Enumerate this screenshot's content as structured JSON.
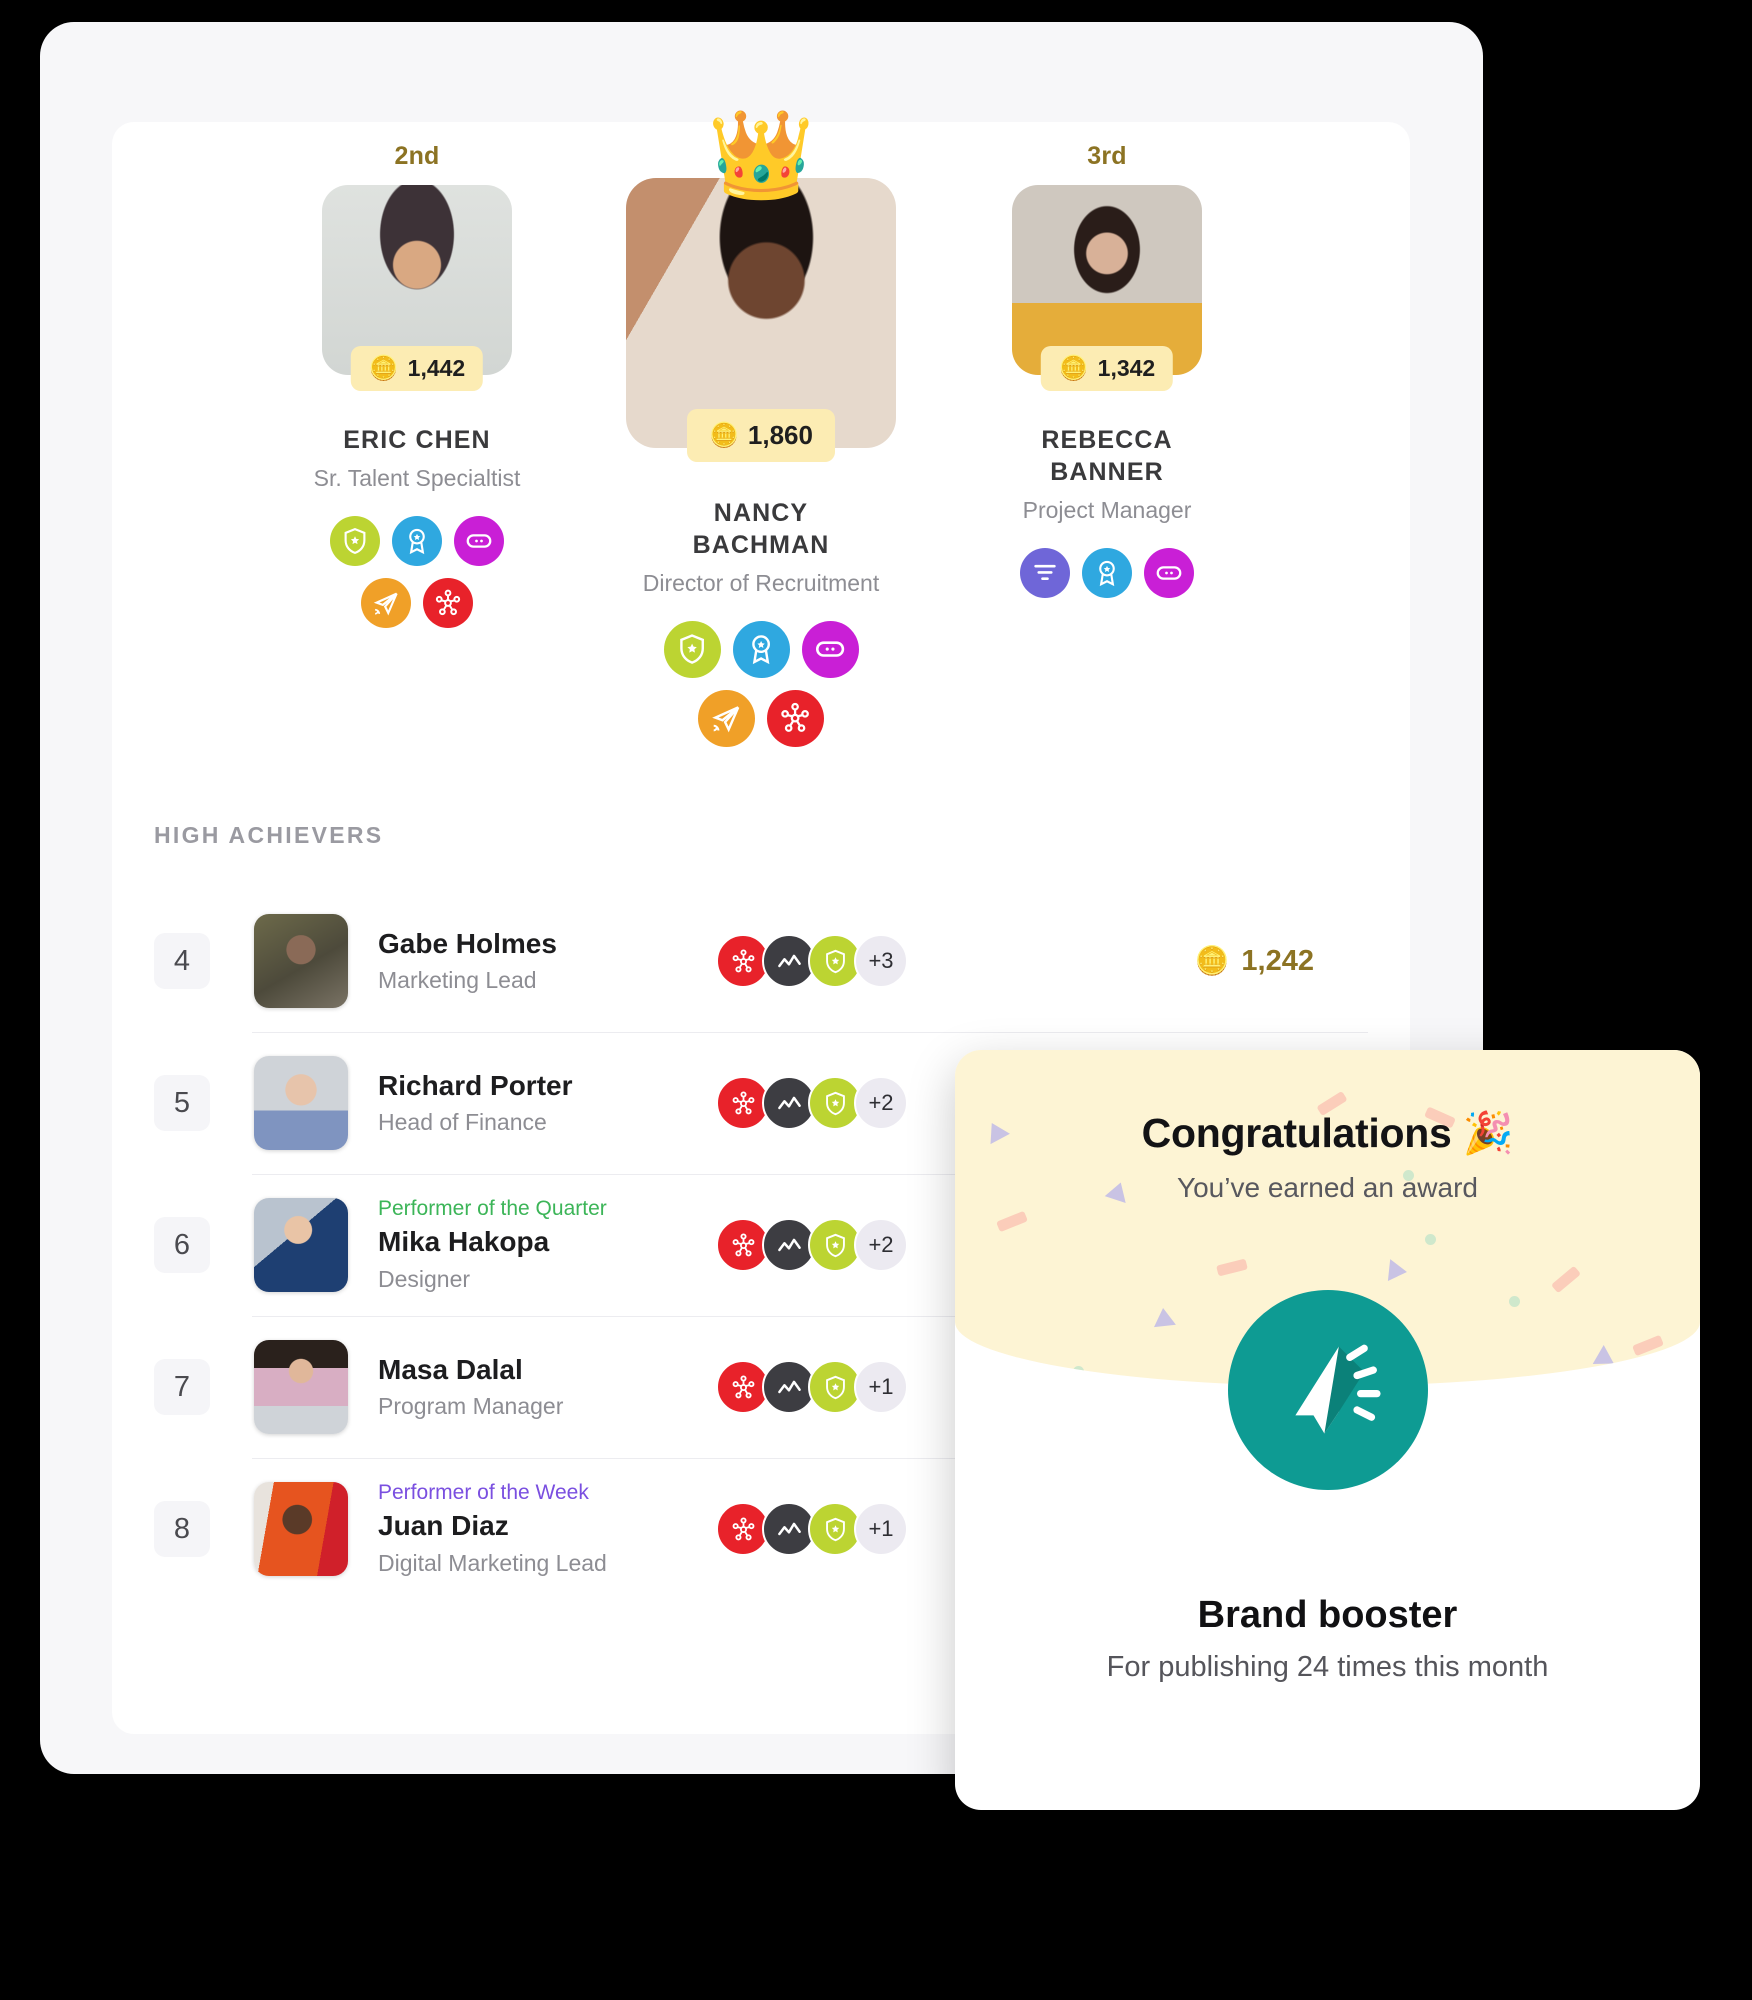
{
  "colors": {
    "background": "#000000",
    "panel": "#f7f7f9",
    "card": "#ffffff",
    "gold": "#8c7323",
    "coin_chip": "#fcecb3",
    "congrats_bg": "#fdf4d4",
    "award_teal": "#0e9b93",
    "quarter_green": "#3cb558",
    "week_purple": "#7a4fe0",
    "badge_red": "#e8222a",
    "badge_dark": "#3d3d42",
    "badge_lime": "#bcd432",
    "badge_blue": "#2fa8e0",
    "badge_magenta": "#c91fd6",
    "badge_orange": "#f0a028",
    "badge_indigo": "#6f66d8",
    "badge_more": "#eceaf1"
  },
  "podium": {
    "second": {
      "rank_label": "2nd",
      "name": "ERIC CHEN",
      "role": "Sr. Talent Specialtist",
      "points": "1,442",
      "coin_icon": "coins-emoji",
      "badges": [
        {
          "icon": "shield-star-icon",
          "color": "#bcd432"
        },
        {
          "icon": "award-ribbon-icon",
          "color": "#2fa8e0"
        },
        {
          "icon": "chat-bubble-icon",
          "color": "#c91fd6"
        },
        {
          "icon": "paper-plane-icon",
          "color": "#f0a028"
        },
        {
          "icon": "network-hub-icon",
          "color": "#e8222a"
        }
      ]
    },
    "first": {
      "rank_label": "",
      "crown_icon": "crown-emoji",
      "name": "NANCY BACHMAN",
      "name_line1": "NANCY",
      "name_line2": "BACHMAN",
      "role": "Director of Recruitment",
      "points": "1,860",
      "coin_icon": "coins-emoji",
      "badges": [
        {
          "icon": "shield-star-icon",
          "color": "#bcd432"
        },
        {
          "icon": "award-ribbon-icon",
          "color": "#2fa8e0"
        },
        {
          "icon": "chat-bubble-icon",
          "color": "#c91fd6"
        },
        {
          "icon": "paper-plane-icon",
          "color": "#f0a028"
        },
        {
          "icon": "network-hub-icon",
          "color": "#e8222a"
        }
      ]
    },
    "third": {
      "rank_label": "3rd",
      "name": "REBECCA BANNER",
      "name_line1": "REBECCA",
      "name_line2": "BANNER",
      "role": "Project Manager",
      "points": "1,342",
      "coin_icon": "coins-emoji",
      "badges": [
        {
          "icon": "filter-funnel-icon",
          "color": "#6f66d8"
        },
        {
          "icon": "award-ribbon-icon",
          "color": "#2fa8e0"
        },
        {
          "icon": "chat-bubble-icon",
          "color": "#c91fd6"
        }
      ]
    }
  },
  "high_achievers": {
    "title": "HIGH ACHIEVERS",
    "rows": [
      {
        "rank": "4",
        "kicker": "",
        "kicker_color": "",
        "name": "Gabe Holmes",
        "role": "Marketing Lead",
        "badges": [
          "network-hub-icon",
          "chart-line-icon",
          "shield-star-icon"
        ],
        "more": "+3",
        "points": "1,242",
        "coin_icon": "coins-emoji"
      },
      {
        "rank": "5",
        "kicker": "",
        "kicker_color": "",
        "name": "Richard Porter",
        "role": "Head of Finance",
        "badges": [
          "network-hub-icon",
          "chart-line-icon",
          "shield-star-icon"
        ],
        "more": "+2",
        "points": "",
        "coin_icon": ""
      },
      {
        "rank": "6",
        "kicker": "Performer of the Quarter",
        "kicker_color": "#3cb558",
        "name": "Mika Hakopa",
        "role": "Designer",
        "badges": [
          "network-hub-icon",
          "chart-line-icon",
          "shield-star-icon"
        ],
        "more": "+2",
        "points": "",
        "coin_icon": ""
      },
      {
        "rank": "7",
        "kicker": "",
        "kicker_color": "",
        "name": "Masa Dalal",
        "role": "Program Manager",
        "badges": [
          "network-hub-icon",
          "chart-line-icon",
          "shield-star-icon"
        ],
        "more": "+1",
        "points": "",
        "coin_icon": ""
      },
      {
        "rank": "8",
        "kicker": "Performer of the Week",
        "kicker_color": "#7a4fe0",
        "name": "Juan Diaz",
        "role": "Digital Marketing Lead",
        "badges": [
          "network-hub-icon",
          "chart-line-icon",
          "shield-star-icon"
        ],
        "more": "+1",
        "points": "",
        "coin_icon": ""
      }
    ]
  },
  "congrats_card": {
    "title": "Congratulations 🎉",
    "subtitle": "You’ve earned an award",
    "award_icon": "megaphone-icon",
    "award_name": "Brand booster",
    "award_desc": "For publishing 24 times this month"
  }
}
